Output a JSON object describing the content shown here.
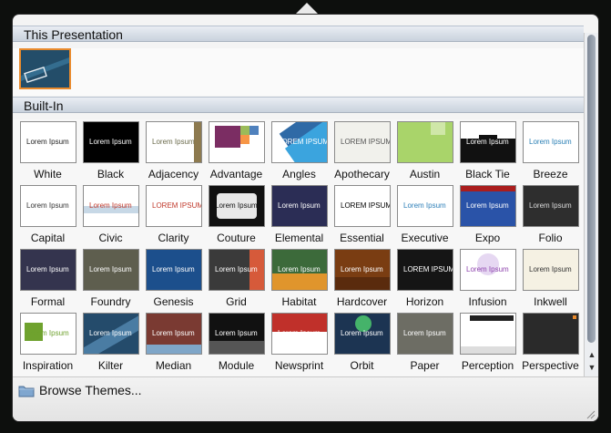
{
  "sections": {
    "this_presentation": "This Presentation",
    "built_in": "Built-In"
  },
  "current_theme_thumb": {
    "colors": [
      "#224b67",
      "#3a7aa0"
    ]
  },
  "themes": [
    {
      "name": "White",
      "thumb_text": "Lorem Ipsum",
      "bg": "#ffffff",
      "fg": "#222222"
    },
    {
      "name": "Black",
      "thumb_text": "Lorem Ipsum",
      "bg": "#000000",
      "fg": "#ffffff"
    },
    {
      "name": "Adjacency",
      "thumb_text": "Lorem Ipsum",
      "bg": "#ffffff",
      "fg": "#6b6b4c"
    },
    {
      "name": "Advantage",
      "thumb_text": "",
      "bg": "#ffffff",
      "fg": "#ffffff"
    },
    {
      "name": "Angles",
      "thumb_text": "LOREM IPSUM",
      "bg": "#ffffff",
      "fg": "#ffffff"
    },
    {
      "name": "Apothecary",
      "thumb_text": "LOREM IPSUM",
      "bg": "#f1f1ec",
      "fg": "#555555"
    },
    {
      "name": "Austin",
      "thumb_text": "",
      "bg": "#8cc152",
      "fg": "#ffffff"
    },
    {
      "name": "Black Tie",
      "thumb_text": "Lorem Ipsum",
      "bg": "#111111",
      "fg": "#ffffff"
    },
    {
      "name": "Breeze",
      "thumb_text": "Lorem Ipsum",
      "bg": "#ffffff",
      "fg": "#2a7fb4"
    },
    {
      "name": "Capital",
      "thumb_text": "Lorem Ipsum",
      "bg": "#ffffff",
      "fg": "#333333"
    },
    {
      "name": "Civic",
      "thumb_text": "Lorem Ipsum",
      "bg": "#ffffff",
      "fg": "#c0392b"
    },
    {
      "name": "Clarity",
      "thumb_text": "LOREM IPSUM",
      "bg": "#ffffff",
      "fg": "#c0392b"
    },
    {
      "name": "Couture",
      "thumb_text": "Lorem Ipsum",
      "bg": "#111111",
      "fg": "#111111"
    },
    {
      "name": "Elemental",
      "thumb_text": "Lorem Ipsum",
      "bg": "#2b2d55",
      "fg": "#ffffff"
    },
    {
      "name": "Essential",
      "thumb_text": "LOREM IPSUM",
      "bg": "#ffffff",
      "fg": "#000000"
    },
    {
      "name": "Executive",
      "thumb_text": "Lorem Ipsum",
      "bg": "#ffffff",
      "fg": "#2d7fb8"
    },
    {
      "name": "Expo",
      "thumb_text": "Lorem Ipsum",
      "bg": "#2a53a8",
      "fg": "#ffffff"
    },
    {
      "name": "Folio",
      "thumb_text": "Lorem Ipsum",
      "bg": "#2e2e2e",
      "fg": "#dddddd"
    },
    {
      "name": "Formal",
      "thumb_text": "Lorem Ipsum",
      "bg": "#34344e",
      "fg": "#ffffff"
    },
    {
      "name": "Foundry",
      "thumb_text": "Lorem Ipsum",
      "bg": "#5e5e4e",
      "fg": "#ffffff"
    },
    {
      "name": "Genesis",
      "thumb_text": "Lorem Ipsum",
      "bg": "#1c4f8c",
      "fg": "#ffffff"
    },
    {
      "name": "Grid",
      "thumb_text": "Lorem Ipsum",
      "bg": "#3a3a3a",
      "fg": "#ffffff"
    },
    {
      "name": "Habitat",
      "thumb_text": "Lorem Ipsum",
      "bg": "#3c6a3a",
      "fg": "#ffffff"
    },
    {
      "name": "Hardcover",
      "thumb_text": "Lorem Ipsum",
      "bg": "#7a3d12",
      "fg": "#ffffff"
    },
    {
      "name": "Horizon",
      "thumb_text": "LOREM IPSUM",
      "bg": "#151515",
      "fg": "#ffffff"
    },
    {
      "name": "Infusion",
      "thumb_text": "Lorem Ipsum",
      "bg": "#ffffff",
      "fg": "#8e44ad"
    },
    {
      "name": "Inkwell",
      "thumb_text": "Lorem Ipsum",
      "bg": "#f5f1e3",
      "fg": "#333333"
    },
    {
      "name": "Inspiration",
      "thumb_text": "Lorem Ipsum",
      "bg": "#ffffff",
      "fg": "#6fa22e"
    },
    {
      "name": "Kilter",
      "thumb_text": "Lorem Ipsum",
      "bg": "#244b6b",
      "fg": "#ffffff"
    },
    {
      "name": "Median",
      "thumb_text": "Lorem Ipsum",
      "bg": "#7a3a32",
      "fg": "#ffffff"
    },
    {
      "name": "Module",
      "thumb_text": "Lorem Ipsum",
      "bg": "#111111",
      "fg": "#ffffff"
    },
    {
      "name": "Newsprint",
      "thumb_text": "Lorem Ipsum",
      "bg": "#ffffff",
      "fg": "#ffffff"
    },
    {
      "name": "Orbit",
      "thumb_text": "Lorem Ipsum",
      "bg": "#1c3452",
      "fg": "#ffffff"
    },
    {
      "name": "Paper",
      "thumb_text": "Lorem Ipsum",
      "bg": "#6d6d64",
      "fg": "#ffffff"
    },
    {
      "name": "Perception",
      "thumb_text": "",
      "bg": "#ffffff",
      "fg": "#333333"
    },
    {
      "name": "Perspective",
      "thumb_text": "",
      "bg": "#2a2a2a",
      "fg": "#ffffff"
    }
  ],
  "footer": {
    "browse_label": "Browse Themes..."
  },
  "accent_selected": "#e98a2c"
}
